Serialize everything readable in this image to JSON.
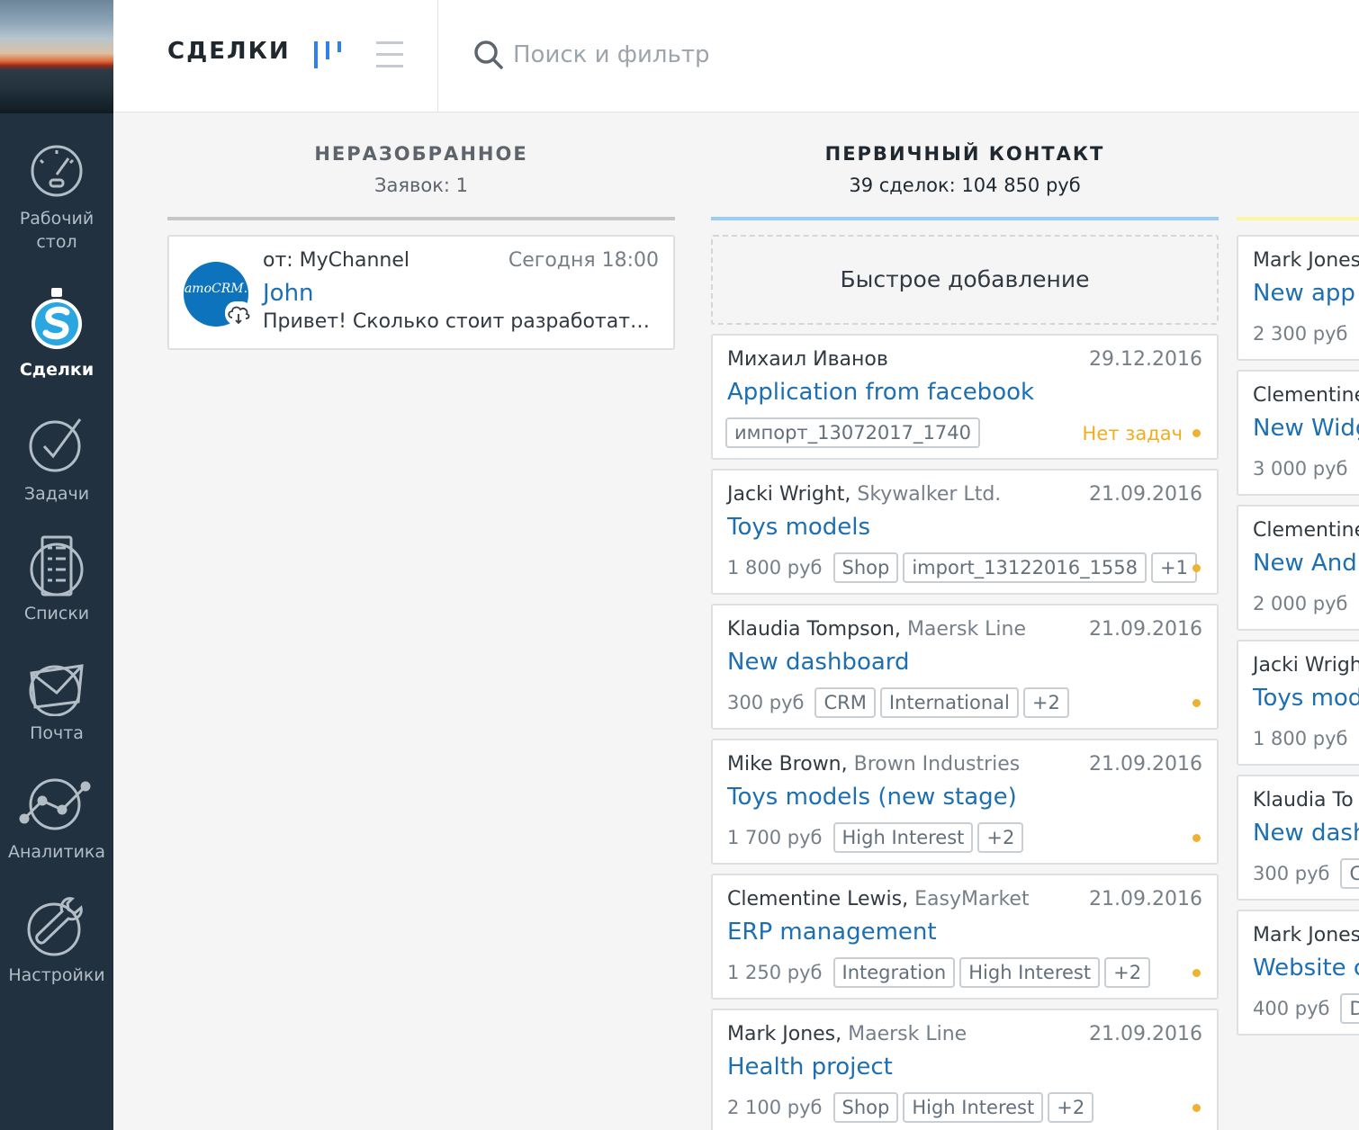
{
  "nav": {
    "items": [
      {
        "label_line1": "Рабочий",
        "label_line2": "стол"
      },
      {
        "label": "Сделки"
      },
      {
        "label": "Задачи"
      },
      {
        "label": "Списки"
      },
      {
        "label": "Почта"
      },
      {
        "label": "Аналитика"
      },
      {
        "label": "Настройки"
      }
    ]
  },
  "header": {
    "title": "СДЕЛКИ",
    "search_placeholder": "Поиск и фильтр"
  },
  "columns": [
    {
      "title": "НЕРАЗОБРАННОЕ",
      "subtitle": "Заявок: 1",
      "color": "#c5c7c9",
      "incoming": {
        "from": "от: MyChannel",
        "date": "Сегодня 18:00",
        "name": "John",
        "message": "Привет! Сколько стоит разработать сайт?",
        "avatar_text": "amoCRM."
      }
    },
    {
      "title": "ПЕРВИЧНЫЙ КОНТАКТ",
      "subtitle": "39 сделок: 104 850 руб",
      "color": "#99ccfd",
      "quick_add": "Быстрое добавление",
      "cards": [
        {
          "contact": "Михаил Иванов",
          "company": "",
          "date": "29.12.2016",
          "title": "Application from facebook",
          "price": "",
          "tags": [
            "импорт_13072017_1740"
          ],
          "status": "Нет задач"
        },
        {
          "contact": "Jacki Wright,",
          "company": "Skywalker Ltd.",
          "date": "21.09.2016",
          "title": "Toys models",
          "price": "1 800 руб",
          "tags": [
            "Shop",
            "import_13122016_1558",
            "+1"
          ],
          "status": ""
        },
        {
          "contact": "Klaudia Tompson,",
          "company": "Maersk Line",
          "date": "21.09.2016",
          "title": "New dashboard",
          "price": "300 руб",
          "tags": [
            "CRM",
            "International",
            "+2"
          ],
          "status": ""
        },
        {
          "contact": "Mike Brown,",
          "company": "Brown Industries",
          "date": "21.09.2016",
          "title": "Toys models (new stage)",
          "price": "1 700 руб",
          "tags": [
            "High Interest",
            "+2"
          ],
          "status": ""
        },
        {
          "contact": "Clementine Lewis,",
          "company": "EasyMarket",
          "date": "21.09.2016",
          "title": "ERP management",
          "price": "1 250 руб",
          "tags": [
            "Integration",
            "High Interest",
            "+2"
          ],
          "status": ""
        },
        {
          "contact": "Mark Jones,",
          "company": "Maersk Line",
          "date": "21.09.2016",
          "title": "Health project",
          "price": "2 100 руб",
          "tags": [
            "Shop",
            "High Interest",
            "+2"
          ],
          "status": ""
        }
      ]
    },
    {
      "color": "#fff4a0",
      "cards": [
        {
          "contact": "Mark Jones",
          "title": "New app",
          "price": "2 300 руб"
        },
        {
          "contact": "Clementine",
          "title": "New Widg",
          "price": "3 000 руб"
        },
        {
          "contact": "Clementine",
          "title": "New Andr",
          "price": "2 000 руб"
        },
        {
          "contact": "Jacki Wrigh",
          "title": "Toys mod",
          "price": "1 800 руб"
        },
        {
          "contact": "Klaudia To",
          "title": "New dash",
          "price": "300 руб",
          "tag": "C"
        },
        {
          "contact": "Mark Jones",
          "title": "Website c",
          "price": "400 руб",
          "tag": "D"
        }
      ]
    }
  ]
}
